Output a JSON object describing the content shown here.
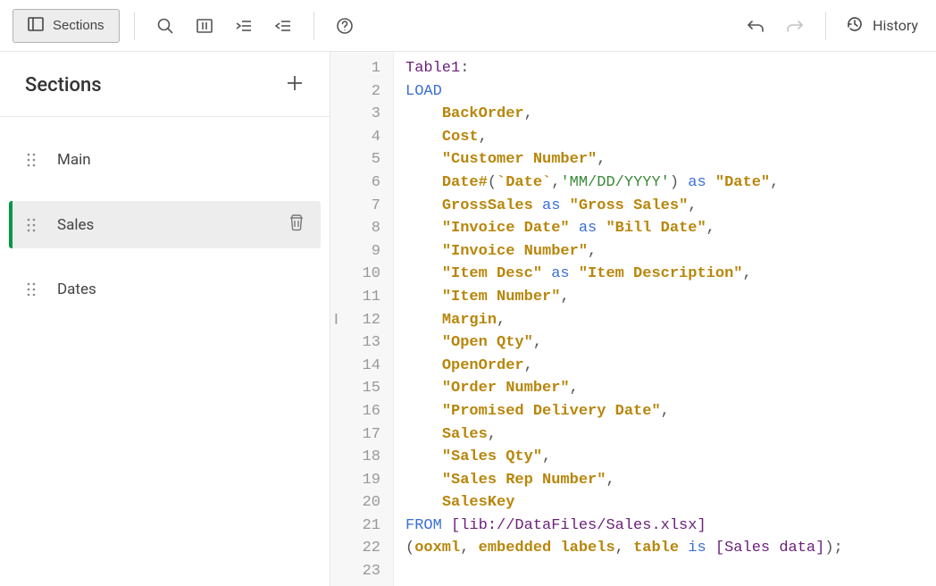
{
  "toolbar": {
    "sections_button": "Sections",
    "history_label": "History"
  },
  "sidebar": {
    "title": "Sections",
    "items": [
      {
        "label": "Main",
        "selected": false
      },
      {
        "label": "Sales",
        "selected": true
      },
      {
        "label": "Dates",
        "selected": false
      }
    ]
  },
  "editor": {
    "lines": [
      [
        {
          "t": "Table1",
          "c": "ident"
        },
        {
          "t": ":",
          "c": "punc"
        }
      ],
      [
        {
          "t": "LOAD",
          "c": "kw"
        }
      ],
      [
        {
          "t": "    ",
          "c": ""
        },
        {
          "t": "BackOrder",
          "c": "fld"
        },
        {
          "t": ",",
          "c": "punc"
        }
      ],
      [
        {
          "t": "    ",
          "c": ""
        },
        {
          "t": "Cost",
          "c": "fld"
        },
        {
          "t": ",",
          "c": "punc"
        }
      ],
      [
        {
          "t": "    ",
          "c": ""
        },
        {
          "t": "\"Customer Number\"",
          "c": "str"
        },
        {
          "t": ",",
          "c": "punc"
        }
      ],
      [
        {
          "t": "    ",
          "c": ""
        },
        {
          "t": "Date#",
          "c": "fld"
        },
        {
          "t": "(",
          "c": "punc"
        },
        {
          "t": "`Date`",
          "c": "fld"
        },
        {
          "t": ",",
          "c": "punc"
        },
        {
          "t": "'MM/DD/YYYY'",
          "c": "lit"
        },
        {
          "t": ")",
          "c": "punc"
        },
        {
          "t": " ",
          "c": ""
        },
        {
          "t": "as",
          "c": "kw"
        },
        {
          "t": " ",
          "c": ""
        },
        {
          "t": "\"Date\"",
          "c": "str"
        },
        {
          "t": ",",
          "c": "punc"
        }
      ],
      [
        {
          "t": "    ",
          "c": ""
        },
        {
          "t": "GrossSales",
          "c": "fld"
        },
        {
          "t": " ",
          "c": ""
        },
        {
          "t": "as",
          "c": "kw"
        },
        {
          "t": " ",
          "c": ""
        },
        {
          "t": "\"Gross Sales\"",
          "c": "str"
        },
        {
          "t": ",",
          "c": "punc"
        }
      ],
      [
        {
          "t": "    ",
          "c": ""
        },
        {
          "t": "\"Invoice Date\"",
          "c": "str"
        },
        {
          "t": " ",
          "c": ""
        },
        {
          "t": "as",
          "c": "kw"
        },
        {
          "t": " ",
          "c": ""
        },
        {
          "t": "\"Bill Date\"",
          "c": "str"
        },
        {
          "t": ",",
          "c": "punc"
        }
      ],
      [
        {
          "t": "    ",
          "c": ""
        },
        {
          "t": "\"Invoice Number\"",
          "c": "str"
        },
        {
          "t": ",",
          "c": "punc"
        }
      ],
      [
        {
          "t": "    ",
          "c": ""
        },
        {
          "t": "\"Item Desc\"",
          "c": "str"
        },
        {
          "t": " ",
          "c": ""
        },
        {
          "t": "as",
          "c": "kw"
        },
        {
          "t": " ",
          "c": ""
        },
        {
          "t": "\"Item Description\"",
          "c": "str"
        },
        {
          "t": ",",
          "c": "punc"
        }
      ],
      [
        {
          "t": "    ",
          "c": ""
        },
        {
          "t": "\"Item Number\"",
          "c": "str"
        },
        {
          "t": ",",
          "c": "punc"
        }
      ],
      [
        {
          "t": "    ",
          "c": ""
        },
        {
          "t": "Margin",
          "c": "fld"
        },
        {
          "t": ",",
          "c": "punc"
        }
      ],
      [
        {
          "t": "    ",
          "c": ""
        },
        {
          "t": "\"Open Qty\"",
          "c": "str"
        },
        {
          "t": ",",
          "c": "punc"
        }
      ],
      [
        {
          "t": "    ",
          "c": ""
        },
        {
          "t": "OpenOrder",
          "c": "fld"
        },
        {
          "t": ",",
          "c": "punc"
        }
      ],
      [
        {
          "t": "    ",
          "c": ""
        },
        {
          "t": "\"Order Number\"",
          "c": "str"
        },
        {
          "t": ",",
          "c": "punc"
        }
      ],
      [
        {
          "t": "    ",
          "c": ""
        },
        {
          "t": "\"Promised Delivery Date\"",
          "c": "str"
        },
        {
          "t": ",",
          "c": "punc"
        }
      ],
      [
        {
          "t": "    ",
          "c": ""
        },
        {
          "t": "Sales",
          "c": "fld"
        },
        {
          "t": ",",
          "c": "punc"
        }
      ],
      [
        {
          "t": "    ",
          "c": ""
        },
        {
          "t": "\"Sales Qty\"",
          "c": "str"
        },
        {
          "t": ",",
          "c": "punc"
        }
      ],
      [
        {
          "t": "    ",
          "c": ""
        },
        {
          "t": "\"Sales Rep Number\"",
          "c": "str"
        },
        {
          "t": ",",
          "c": "punc"
        }
      ],
      [
        {
          "t": "    ",
          "c": ""
        },
        {
          "t": "SalesKey",
          "c": "fld"
        }
      ],
      [
        {
          "t": "FROM",
          "c": "kw"
        },
        {
          "t": " ",
          "c": ""
        },
        {
          "t": "[lib://DataFiles/Sales.xlsx]",
          "c": "brack"
        }
      ],
      [
        {
          "t": "(",
          "c": "punc"
        },
        {
          "t": "ooxml",
          "c": "fld"
        },
        {
          "t": ", ",
          "c": "punc"
        },
        {
          "t": "embedded",
          "c": "fld"
        },
        {
          "t": " ",
          "c": ""
        },
        {
          "t": "labels",
          "c": "fld"
        },
        {
          "t": ", ",
          "c": "punc"
        },
        {
          "t": "table",
          "c": "fld"
        },
        {
          "t": " ",
          "c": ""
        },
        {
          "t": "is",
          "c": "kw"
        },
        {
          "t": " ",
          "c": ""
        },
        {
          "t": "[Sales data]",
          "c": "brack"
        },
        {
          "t": ");",
          "c": "punc"
        }
      ],
      []
    ]
  }
}
